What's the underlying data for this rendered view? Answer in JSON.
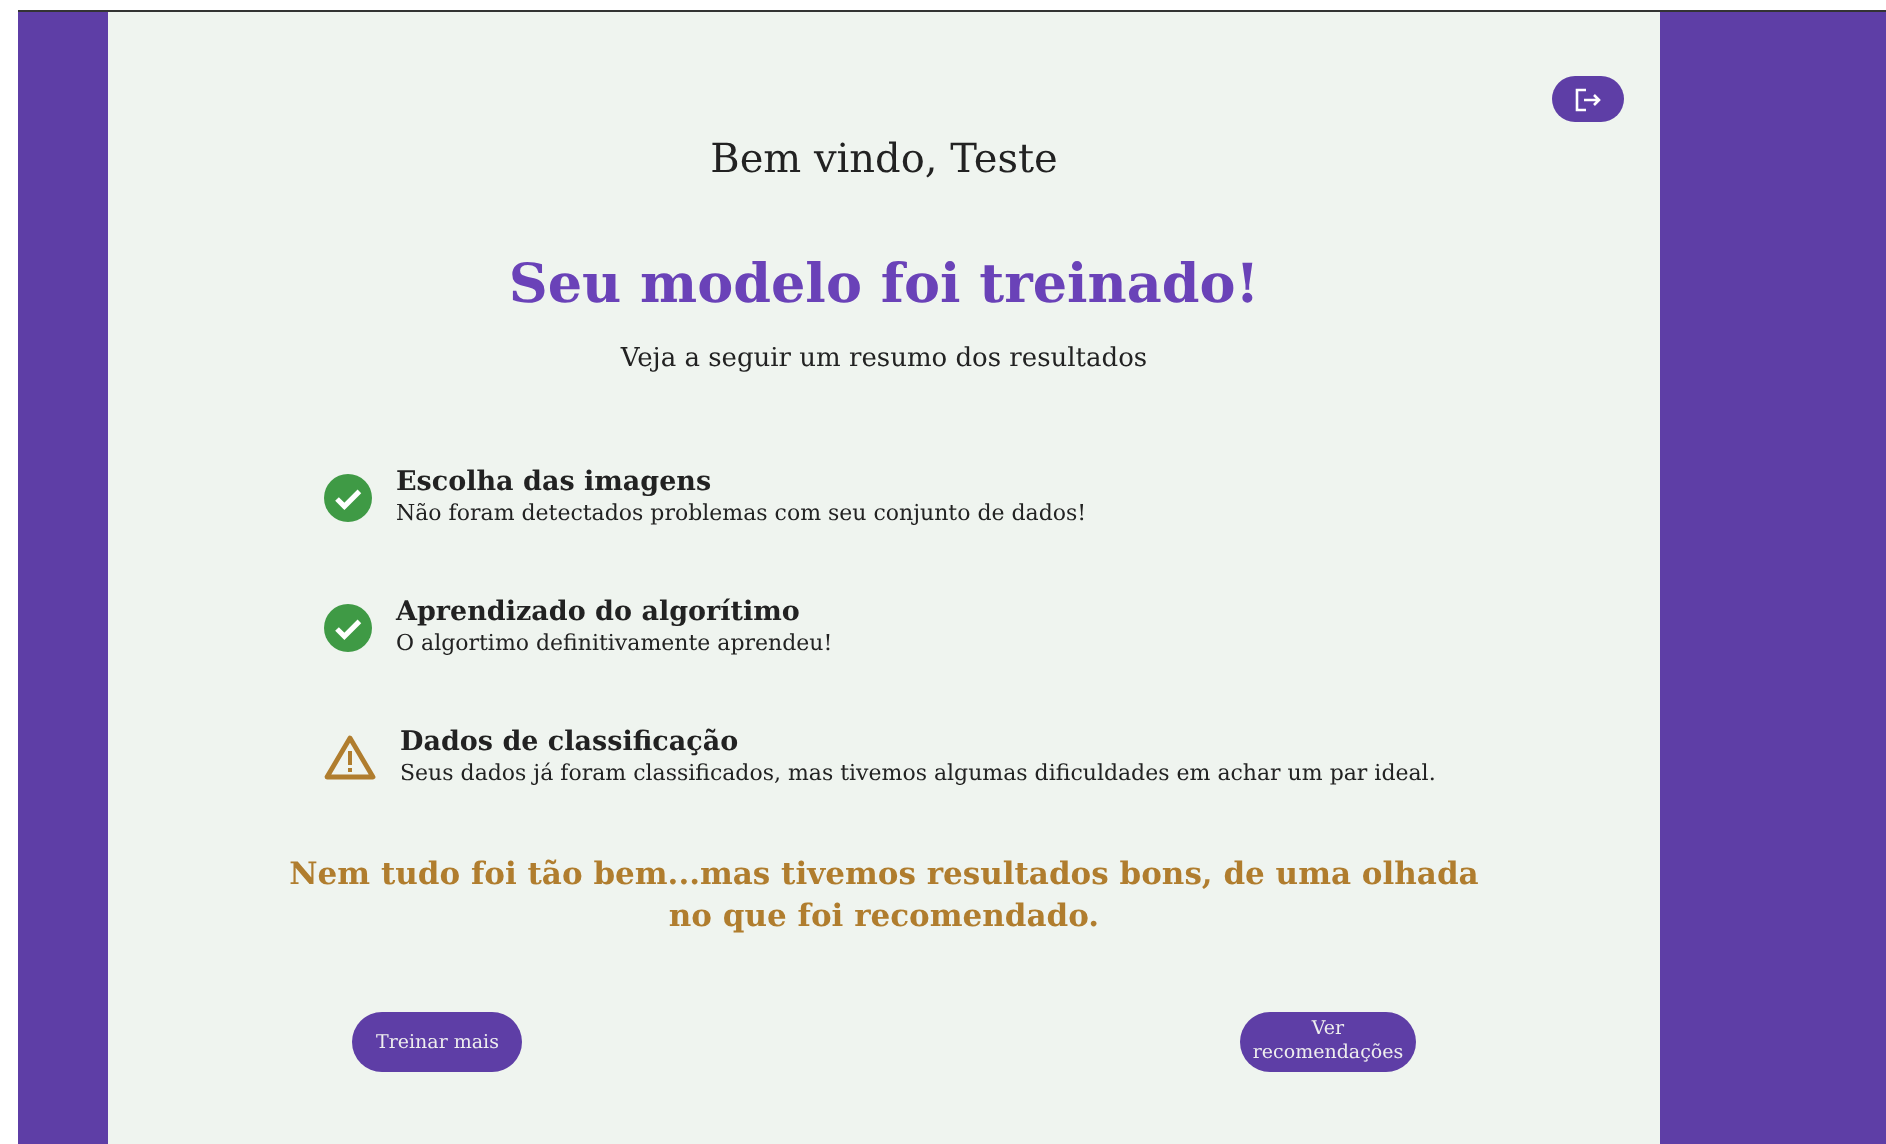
{
  "greeting": "Bem vindo, Teste",
  "title": "Seu modelo foi treinado!",
  "subtitle": "Veja a seguir um resumo dos resultados",
  "results": [
    {
      "kind": "success",
      "title": "Escolha das imagens",
      "description": "Não foram detectados problemas com seu conjunto de dados!"
    },
    {
      "kind": "success",
      "title": "Aprendizado do algorítimo",
      "description": "O algortimo definitivamente aprendeu!"
    },
    {
      "kind": "warning",
      "title": "Dados de classificação",
      "description": "Seus dados já foram classificados, mas tivemos algumas dificuldades em achar um par ideal."
    }
  ],
  "conclusion": "Nem tudo foi tão bem...mas tivemos resultados bons, de uma olhada no que foi recomendado.",
  "buttons": [
    "Treinar mais",
    "Ver recomendações"
  ]
}
